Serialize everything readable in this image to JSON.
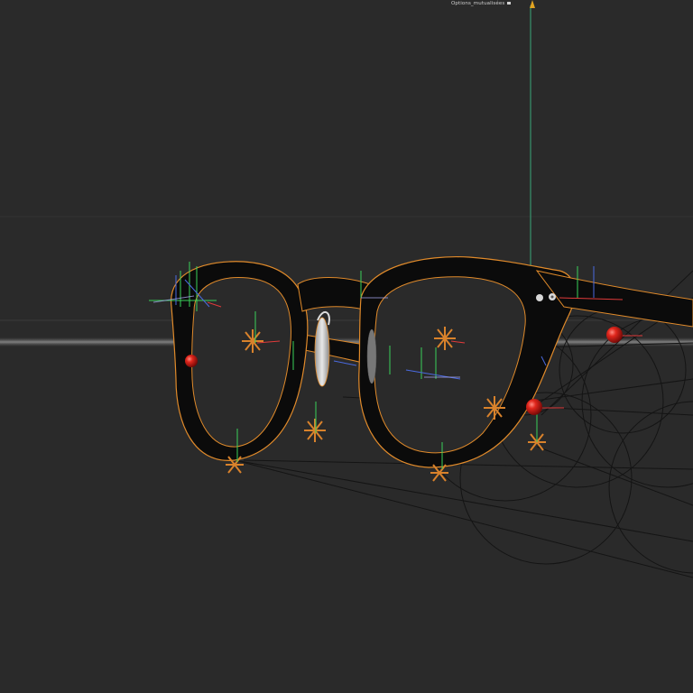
{
  "viewport": {
    "camera_label": "Options_mutualisées",
    "camera_icon": "camera-icon",
    "background_color": "#2a2a2a"
  },
  "scene": {
    "object": "eyeglasses-frame",
    "selection_color": "#e08a2a",
    "frame_color": "#0d0d0d",
    "null_color": "#d9822b",
    "joint_color": "#d11a14",
    "axis_colors": {
      "x": "#e03a3a",
      "y": "#3ad05a",
      "z": "#4a6ae0"
    },
    "spline_color": "#111111"
  }
}
